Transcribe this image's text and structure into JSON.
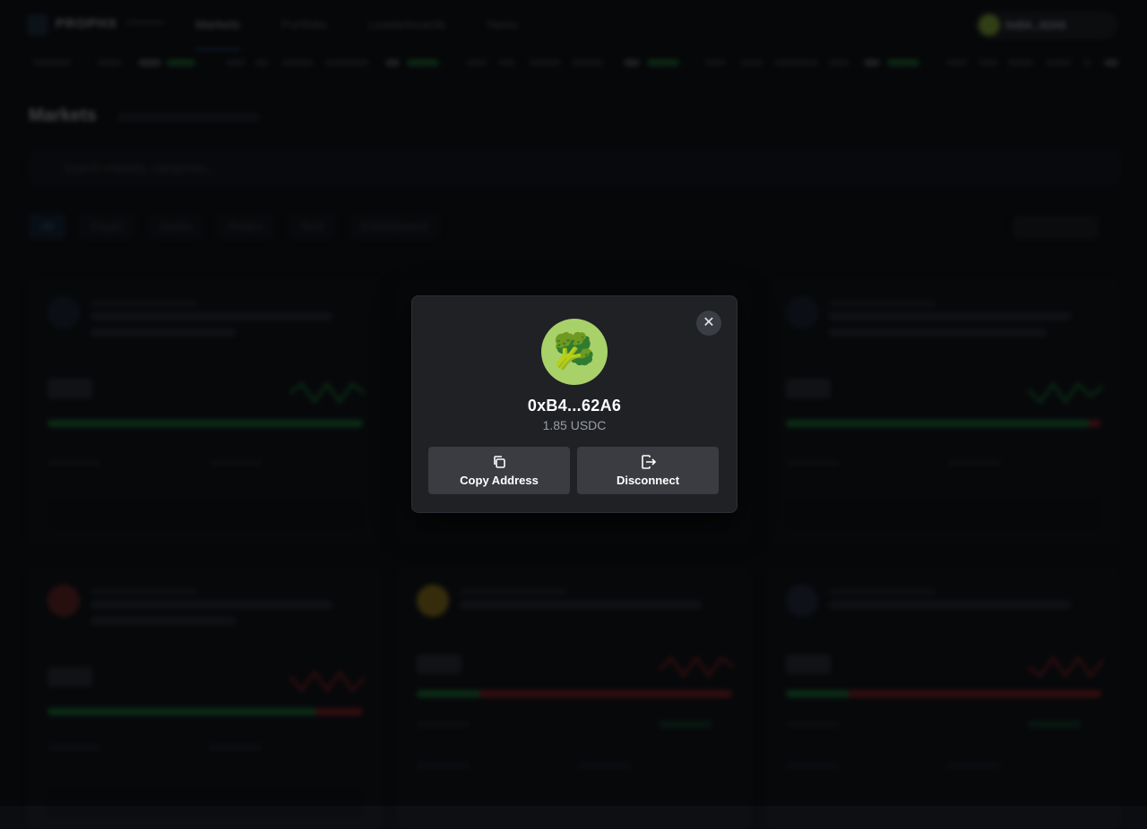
{
  "background": {
    "brand": "PROPHX",
    "nav": [
      "Markets",
      "Portfolio",
      "Leaderboards",
      "News"
    ],
    "wallet_label": "0xB4...62A6",
    "page_title": "Markets",
    "search_placeholder": "Search markets, categories...",
    "filters": [
      "All",
      "Crypto",
      "Sports",
      "Politics",
      "Tech",
      "Entertainment"
    ]
  },
  "modal": {
    "avatar_emoji": "🥦",
    "address": "0xB4...62A6",
    "balance": "1.85 USDC",
    "copy_label": "Copy Address",
    "disconnect_label": "Disconnect",
    "close_glyph": "✕"
  },
  "colors": {
    "modal_bg": "#1f2125",
    "button_bg": "#3a3c41",
    "avatar_bg": "#a8d16a",
    "positive": "#1d8b3b",
    "negative": "#a02525"
  }
}
